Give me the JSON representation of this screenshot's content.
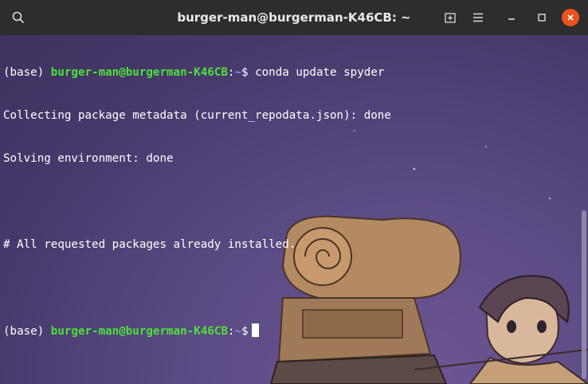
{
  "window": {
    "title": "burger-man@burgerman-K46CB: ~"
  },
  "titlebar_icons": [
    "search-icon",
    "new-tab-icon",
    "hamburger-menu-icon",
    "minimize-icon",
    "maximize-icon",
    "close-icon"
  ],
  "terminal": {
    "line1": {
      "env": "(base) ",
      "userhost": "burger-man@burgerman-K46CB",
      "colon": ":",
      "path": "~",
      "prompt": "$ ",
      "command": "conda update spyder"
    },
    "line2": "Collecting package metadata (current_repodata.json): done",
    "line3": "Solving environment: done",
    "line4": "",
    "line5": "# All requested packages already installed.",
    "line6": "",
    "line7": {
      "env": "(base) ",
      "userhost": "burger-man@burgerman-K46CB",
      "colon": ":",
      "path": "~",
      "prompt": "$"
    }
  },
  "colors": {
    "titlebar": "#2d2d2d",
    "close_button": "#e95420",
    "prompt_user": "#4ee13a",
    "prompt_path": "#7b9af5",
    "text": "#ffffff"
  }
}
